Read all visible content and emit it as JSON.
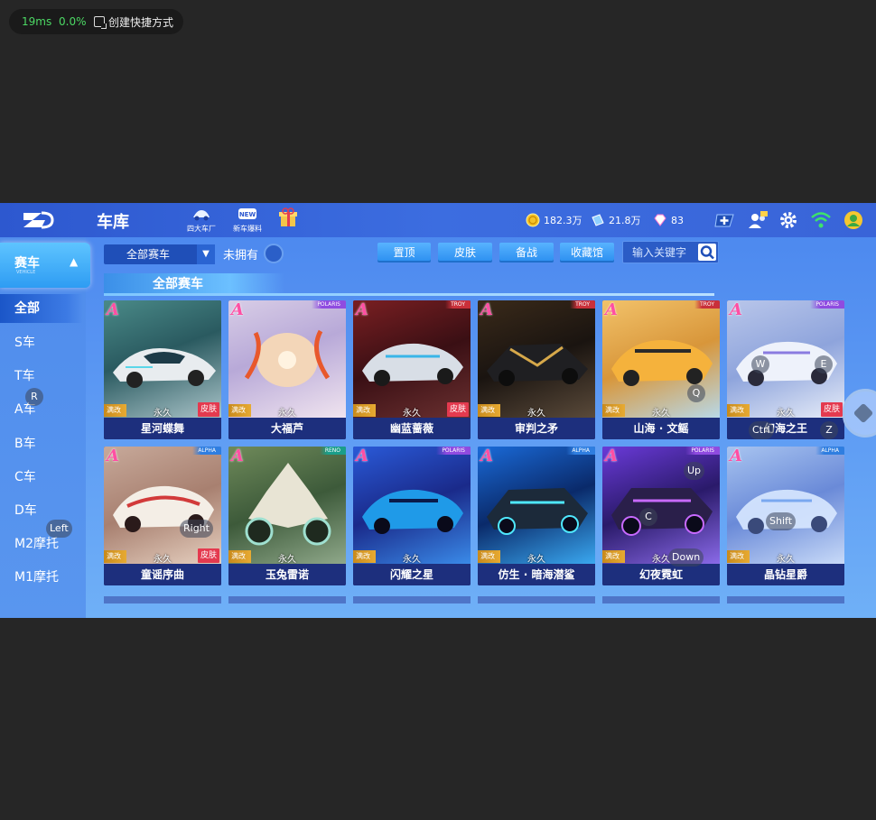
{
  "overlay": {
    "latency": "19ms",
    "loss": "0.0%",
    "shortcut_label": "创建快捷方式"
  },
  "topbar": {
    "title": "车库",
    "icons": [
      {
        "name": "factory-icon",
        "label": "四大车厂"
      },
      {
        "name": "new-car-icon",
        "label": "新车爆料"
      },
      {
        "name": "gift-icon",
        "label": ""
      }
    ],
    "resources": {
      "coins": "182.3万",
      "tickets": "21.8万",
      "diamonds": "83"
    }
  },
  "sidebar": {
    "header": "赛车",
    "header_sub": "VEHICLE",
    "items": [
      "全部",
      "S车",
      "T车",
      "A车",
      "B车",
      "C车",
      "D车",
      "M2摩托",
      "M1摩托"
    ]
  },
  "filters": {
    "dropdown_value": "全部赛车",
    "owned_label": "未拥有",
    "buttons": [
      "置顶",
      "皮肤",
      "备战",
      "收藏馆"
    ],
    "search_placeholder": "输入关键字"
  },
  "section_title": "全部赛车",
  "cards": [
    {
      "name": "星河蝶舞",
      "grade": "A",
      "brand": "",
      "mod": "满改",
      "duration": "永久",
      "skin": "皮肤"
    },
    {
      "name": "大福芦",
      "grade": "A",
      "brand": "POLARIS",
      "mod": "满改",
      "duration": "永久",
      "skin": ""
    },
    {
      "name": "幽蓝蔷薇",
      "grade": "A",
      "brand": "TROY",
      "mod": "满改",
      "duration": "永久",
      "skin": "皮肤"
    },
    {
      "name": "审判之矛",
      "grade": "A",
      "brand": "TROY",
      "mod": "满改",
      "duration": "永久",
      "skin": ""
    },
    {
      "name": "山海 · 文鳐",
      "grade": "A",
      "brand": "TROY",
      "mod": "满改",
      "duration": "永久",
      "skin": ""
    },
    {
      "name": "幻海之王",
      "grade": "A",
      "brand": "POLARIS",
      "mod": "满改",
      "duration": "永久",
      "skin": "皮肤"
    },
    {
      "name": "童谣序曲",
      "grade": "A",
      "brand": "ALPHA",
      "mod": "满改",
      "duration": "永久",
      "skin": "皮肤"
    },
    {
      "name": "玉兔雷诺",
      "grade": "A",
      "brand": "RENO",
      "mod": "满改",
      "duration": "永久",
      "skin": ""
    },
    {
      "name": "闪耀之星",
      "grade": "A",
      "brand": "POLARIS",
      "mod": "满改",
      "duration": "永久",
      "skin": ""
    },
    {
      "name": "仿生 · 暗海潜鲨",
      "grade": "A",
      "brand": "ALPHA",
      "mod": "满改",
      "duration": "永久",
      "skin": ""
    },
    {
      "name": "幻夜霓虹",
      "grade": "A",
      "brand": "POLARIS",
      "mod": "满改",
      "duration": "永久",
      "skin": ""
    },
    {
      "name": "晶钻星爵",
      "grade": "A",
      "brand": "ALPHA",
      "mod": "满改",
      "duration": "永久",
      "skin": ""
    }
  ],
  "key_hints": [
    "R",
    "Left",
    "Right",
    "Q",
    "W",
    "E",
    "Ctrl",
    "Z",
    "Up",
    "C",
    "Down",
    "Shift"
  ],
  "colors": {
    "accent": "#3c6de0",
    "card_name_bg": "#1d2f7d",
    "grade": "#ff4fa3",
    "skin_tag": "#e43a4f",
    "mod_tag": "#e7aa32"
  }
}
